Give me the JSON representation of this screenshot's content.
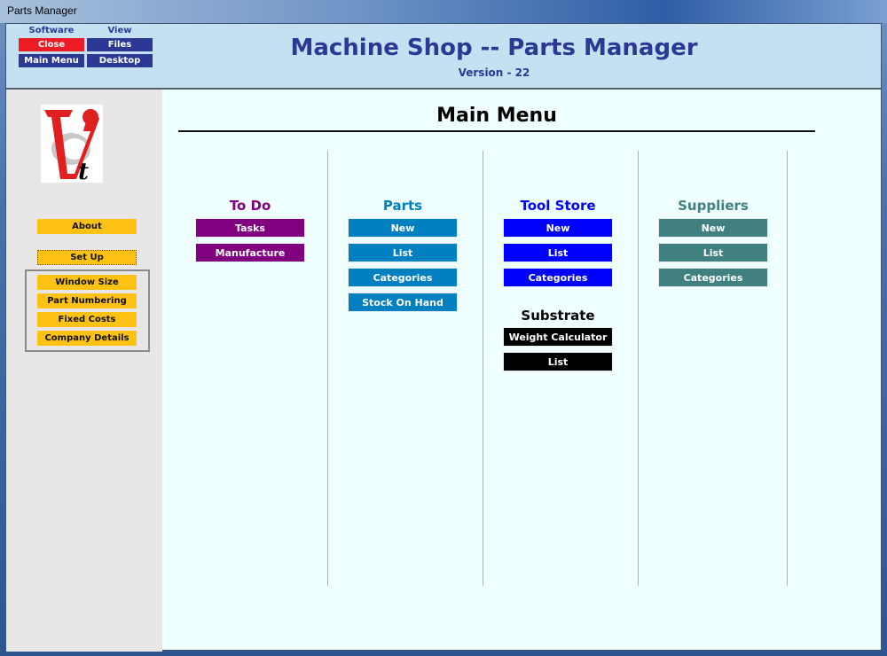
{
  "window": {
    "title": "Parts Manager"
  },
  "header": {
    "software_heading": "Software",
    "view_heading": "View",
    "close_label": "Close",
    "main_menu_label": "Main Menu",
    "files_label": "Files",
    "desktop_label": "Desktop",
    "title": "Machine Shop -- Parts Manager",
    "version": "Version - 22"
  },
  "sidebar": {
    "logo": "vt-logo",
    "about_label": "About",
    "setup_label": "Set Up",
    "setup_items": [
      "Window Size",
      "Part Numbering",
      "Fixed Costs",
      "Company Details"
    ]
  },
  "main": {
    "title": "Main Menu",
    "columns": [
      {
        "heading": "To Do",
        "color": "#800080",
        "buttons": [
          "Tasks",
          "Manufacture"
        ]
      },
      {
        "heading": "Parts",
        "color": "#0080c0",
        "buttons": [
          "New",
          "List",
          "Categories",
          "Stock On Hand"
        ]
      },
      {
        "heading": "Tool Store",
        "color": "#0000ff",
        "buttons": [
          "New",
          "List",
          "Categories"
        ]
      },
      {
        "heading": "Suppliers",
        "color": "#408080",
        "buttons": [
          "New",
          "List",
          "Categories"
        ]
      }
    ],
    "substrate": {
      "heading": "Substrate",
      "color": "#000000",
      "buttons": [
        "Weight Calculator",
        "List"
      ]
    }
  },
  "colors": {
    "close_button": "#ed1c24",
    "nav_button": "#2b3894",
    "sidebar_button": "#fdc213"
  }
}
